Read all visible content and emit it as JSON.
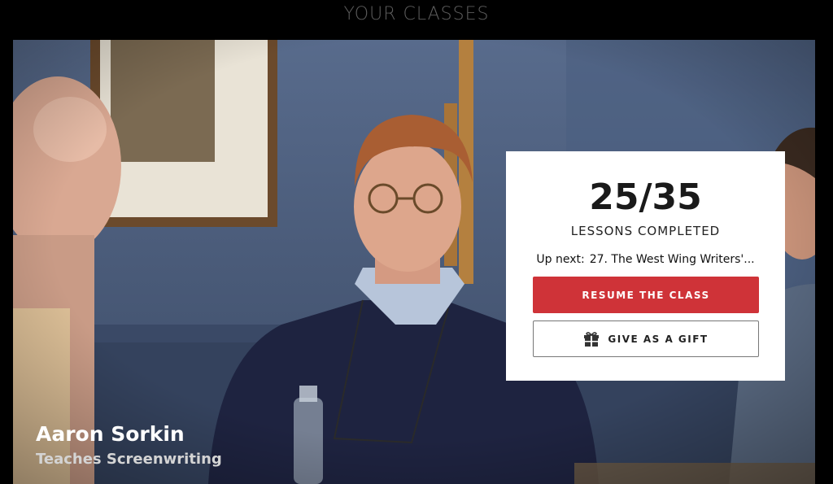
{
  "header": {
    "title": "YOUR CLASSES"
  },
  "hero": {
    "instructor_name": "Aaron Sorkin",
    "course_title": "Teaches Screenwriting"
  },
  "card": {
    "progress_count": "25/35",
    "progress_label": "LESSONS COMPLETED",
    "up_next_prefix": "Up next:",
    "up_next_lesson": "27. The West Wing Writers'...",
    "resume_label": "RESUME THE CLASS",
    "gift_label": "GIVE AS A GIFT",
    "gift_icon": "gift-icon"
  },
  "colors": {
    "resume_button": "#cf3338",
    "background": "#000000",
    "card": "#ffffff"
  }
}
